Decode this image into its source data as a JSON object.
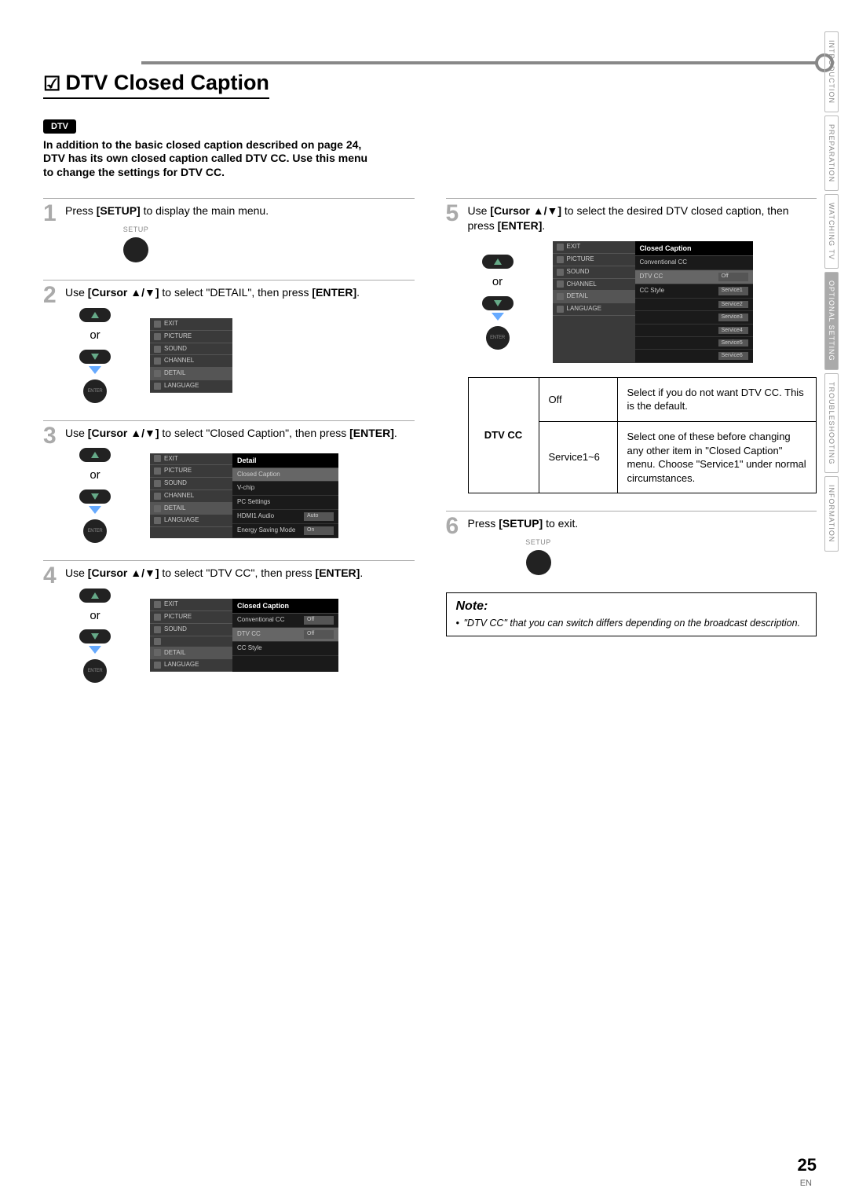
{
  "title": "DTV Closed Caption",
  "dtv_badge": "DTV",
  "intro": "In addition to the basic closed caption described on page 24, DTV has its own closed caption called DTV CC. Use this menu to change the settings for DTV CC.",
  "setup_label": "SETUP",
  "enter_label": "ENTER",
  "or_text": "or",
  "osd_menu": {
    "items": [
      "EXIT",
      "PICTURE",
      "SOUND",
      "CHANNEL",
      "DETAIL",
      "LANGUAGE"
    ]
  },
  "detail_panel": {
    "title": "Detail",
    "rows": [
      {
        "label": "Closed Caption",
        "val": ""
      },
      {
        "label": "V-chip",
        "val": ""
      },
      {
        "label": "PC Settings",
        "val": ""
      },
      {
        "label": "HDMI1 Audio",
        "val": "Auto"
      },
      {
        "label": "Energy Saving Mode",
        "val": "On"
      }
    ]
  },
  "cc_panel": {
    "title": "Closed Caption",
    "rows": [
      {
        "label": "Conventional CC",
        "val": "Off"
      },
      {
        "label": "DTV CC",
        "val": "Off"
      },
      {
        "label": "CC Style",
        "val": ""
      }
    ]
  },
  "cc_panel5": {
    "title": "Closed Caption",
    "rows": [
      {
        "label": "Conventional CC",
        "val": ""
      },
      {
        "label": "DTV CC",
        "val": "Off"
      },
      {
        "label": "CC Style",
        "val": "",
        "services": [
          "Service1",
          "Service2",
          "Service3",
          "Service4",
          "Service5",
          "Service6"
        ]
      }
    ]
  },
  "steps": {
    "1": {
      "text_a": "Press ",
      "b1": "[SETUP]",
      "text_b": " to display the main menu."
    },
    "2": {
      "text_a": "Use ",
      "b1": "[Cursor ▲/▼]",
      "text_b": " to select \"DETAIL\", then press ",
      "b2": "[ENTER]",
      "text_c": "."
    },
    "3": {
      "text_a": "Use ",
      "b1": "[Cursor ▲/▼]",
      "text_b": " to select \"Closed Caption\", then press ",
      "b2": "[ENTER]",
      "text_c": "."
    },
    "4": {
      "text_a": "Use ",
      "b1": "[Cursor ▲/▼]",
      "text_b": " to select \"DTV CC\", then press ",
      "b2": "[ENTER]",
      "text_c": "."
    },
    "5": {
      "text_a": "Use ",
      "b1": "[Cursor ▲/▼]",
      "text_b": " to select the desired DTV closed caption, then press ",
      "b2": "[ENTER]",
      "text_c": "."
    },
    "6": {
      "text_a": "Press ",
      "b1": "[SETUP]",
      "text_b": " to exit."
    }
  },
  "dtv_table": {
    "header": "DTV CC",
    "r1": {
      "opt": "Off",
      "desc": "Select if you do not want DTV CC. This is the default."
    },
    "r2": {
      "opt": "Service1~6",
      "desc": "Select one of these before changing any other item in \"Closed Caption\" menu. Choose \"Service1\" under normal circumstances."
    }
  },
  "note": {
    "h": "Note:",
    "li": "\"DTV CC\" that you can switch differs depending on the broadcast description."
  },
  "side_tabs": [
    "INTRODUCTION",
    "PREPARATION",
    "WATCHING TV",
    "OPTIONAL SETTING",
    "TROUBLESHOOTING",
    "INFORMATION"
  ],
  "page_num": "25",
  "page_en": "EN"
}
